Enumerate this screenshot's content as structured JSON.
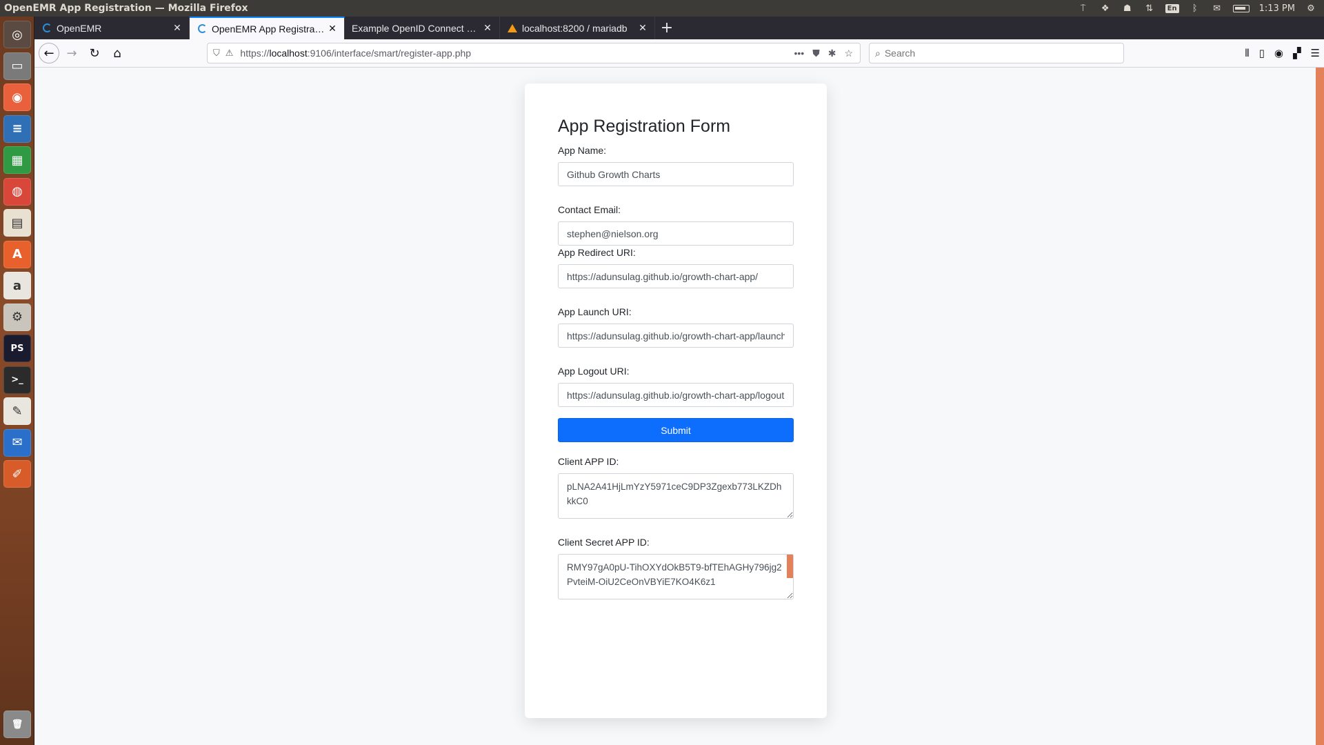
{
  "window_title": "OpenEMR App Registration — Mozilla Firefox",
  "panel": {
    "keyboard": "En",
    "time": "1:13 PM"
  },
  "launcher": {
    "items": [
      {
        "name": "dash-icon",
        "glyph": "◎",
        "bg": "#5a4a42"
      },
      {
        "name": "files-icon",
        "glyph": "▭",
        "bg": "#7a7a7a"
      },
      {
        "name": "firefox-icon",
        "glyph": "◉",
        "bg": "#e8613c"
      },
      {
        "name": "writer-icon",
        "glyph": "≡",
        "bg": "#2f6fb6"
      },
      {
        "name": "calc-icon",
        "glyph": "▦",
        "bg": "#2f9a43"
      },
      {
        "name": "chrome-icon",
        "glyph": "◍",
        "bg": "#d9473a"
      },
      {
        "name": "impress-icon",
        "glyph": "▤",
        "bg": "#e8e0d0"
      },
      {
        "name": "software-center-icon",
        "glyph": "A",
        "bg": "#e8612c"
      },
      {
        "name": "amazon-icon",
        "glyph": "a",
        "bg": "#e9e6df"
      },
      {
        "name": "settings-icon",
        "glyph": "⚙",
        "bg": "#c9c4bc"
      },
      {
        "name": "phpstorm-icon",
        "glyph": "PS",
        "bg": "#1b1b2f"
      },
      {
        "name": "terminal-icon",
        "glyph": ">_",
        "bg": "#2b2b2b"
      },
      {
        "name": "text-editor-icon",
        "glyph": "✎",
        "bg": "#e9e6df"
      },
      {
        "name": "thunderbird-icon",
        "glyph": "✉",
        "bg": "#2a6fc9"
      },
      {
        "name": "pen-tool-icon",
        "glyph": "✐",
        "bg": "#d75c2a"
      },
      {
        "name": "trash-icon",
        "glyph": "🗑",
        "bg": "#8a8a8a"
      }
    ]
  },
  "tabs": [
    {
      "label": "OpenEMR",
      "icon": "openemr-icon",
      "active": false
    },
    {
      "label": "OpenEMR App Registration",
      "icon": "openemr-icon",
      "active": true
    },
    {
      "label": "Example OpenID Connect Client",
      "icon": "none",
      "active": false
    },
    {
      "label": "localhost:8200 / mariadb",
      "icon": "phpmyadmin-icon",
      "active": false
    }
  ],
  "url": {
    "prefix": "https://",
    "host": "localhost",
    "rest": ":9106/interface/smart/register-app.php"
  },
  "search": {
    "placeholder": "Search"
  },
  "form": {
    "title": "App Registration Form",
    "app_name": {
      "label": "App Name:",
      "value": "Github Growth Charts"
    },
    "contact_email": {
      "label": "Contact Email:",
      "value": "stephen@nielson.org"
    },
    "redirect_uri": {
      "label": "App Redirect URI:",
      "value": "https://adunsulag.github.io/growth-chart-app/"
    },
    "launch_uri": {
      "label": "App Launch URI:",
      "value": "https://adunsulag.github.io/growth-chart-app/launch.html"
    },
    "logout_uri": {
      "label": "App Logout URI:",
      "value": "https://adunsulag.github.io/growth-chart-app/logout"
    },
    "submit_label": "Submit",
    "client_id": {
      "label": "Client APP ID:",
      "value": "pLNA2A41HjLmYzY5971ceC9DP3Zgexb773LKZDhkkC0"
    },
    "client_secret": {
      "label": "Client Secret APP ID:",
      "value": "RMY97gA0pU-TihOXYdOkB5T9-bfTEhAGHy796jg2PvteiM-OiU2CeOnVBYiE7KO4K6z1"
    }
  },
  "colors": {
    "submit": "#0d6efd",
    "tab_accent": "#0a84ff",
    "page_bg": "#f7f8fa"
  }
}
